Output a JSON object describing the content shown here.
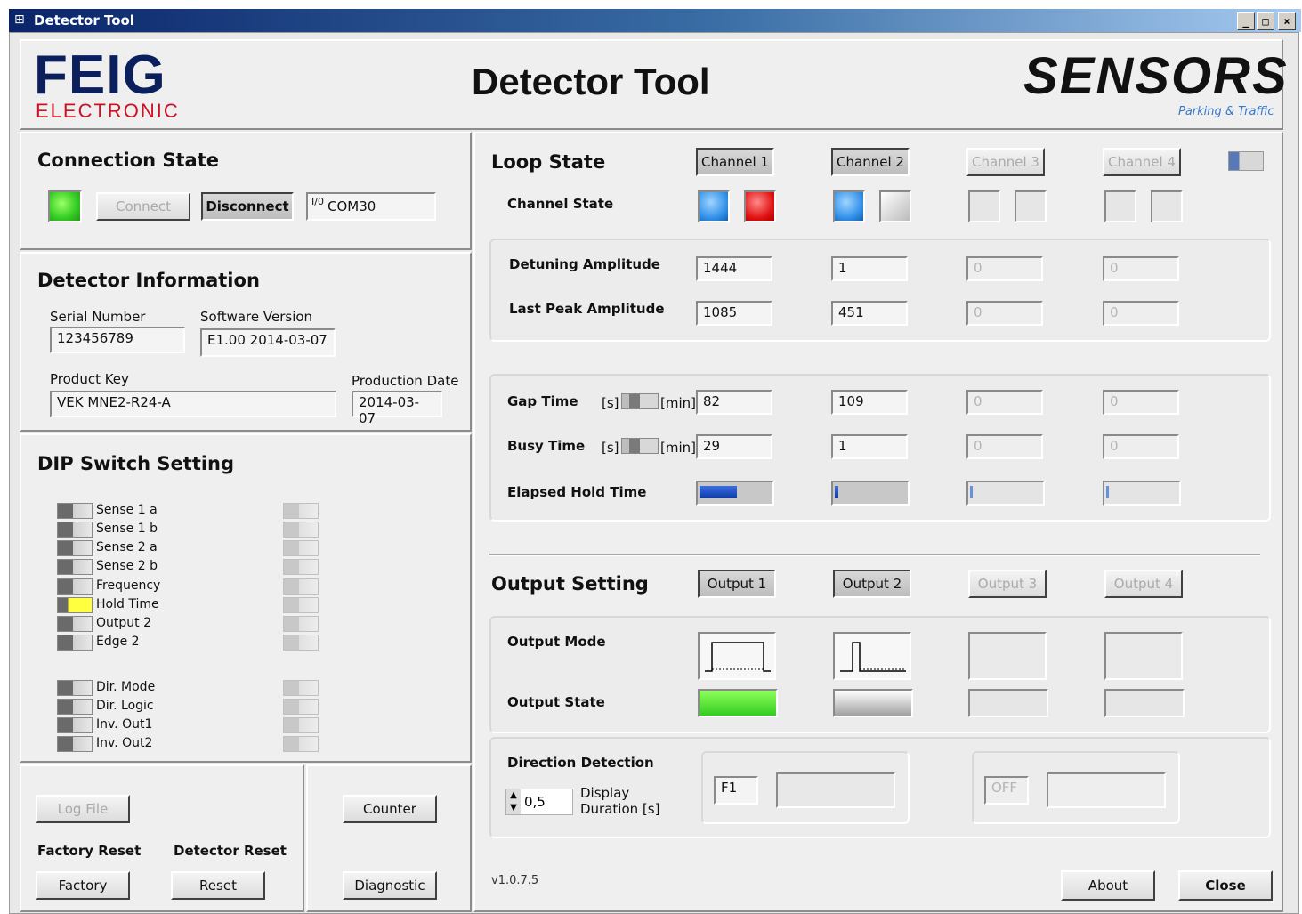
{
  "window": {
    "title": "Detector Tool",
    "min": "_",
    "max": "□",
    "close": "×"
  },
  "header": {
    "logo_main": "FEIG",
    "logo_sub": "ELECTRONIC",
    "app_title": "Detector Tool",
    "brand": "SENSORS",
    "brand_sub": "Parking & Traffic"
  },
  "connection": {
    "title": "Connection State",
    "connect": "Connect",
    "disconnect": "Disconnect",
    "port_icon": "I/0",
    "port": "COM30"
  },
  "info": {
    "title": "Detector Information",
    "serial_label": "Serial Number",
    "serial": "123456789",
    "software_label": "Software Version",
    "software": "E1.00 2014-03-07",
    "product_key_label": "Product Key",
    "product_key": "VEK MNE2-R24-A",
    "production_label": "Production Date",
    "production": "2014-03-07"
  },
  "dip": {
    "title": "DIP Switch Setting",
    "items": [
      "Sense 1 a",
      "Sense 1 b",
      "Sense 2 a",
      "Sense 2 b",
      "Frequency",
      "Hold Time",
      "Output 2",
      "Edge 2",
      "Dir. Mode",
      "Dir. Logic",
      "Inv. Out1",
      "Inv. Out2"
    ]
  },
  "bottom_left": {
    "log_file": "Log File",
    "factory_reset_label": "Factory Reset",
    "detector_reset_label": "Detector Reset",
    "factory": "Factory",
    "reset": "Reset",
    "counter": "Counter",
    "diagnostic": "Diagnostic"
  },
  "loop": {
    "title": "Loop State",
    "channels": [
      "Channel 1",
      "Channel 2",
      "Channel 3",
      "Channel 4"
    ],
    "channel_state_label": "Channel State",
    "detuning_label": "Detuning Amplitude",
    "detuning": [
      "1444",
      "1",
      "0",
      "0"
    ],
    "last_peak_label": "Last Peak Amplitude",
    "last_peak": [
      "1085",
      "451",
      "0",
      "0"
    ],
    "gap_label": "Gap Time",
    "busy_label": "Busy Time",
    "unit_s": "[s]",
    "unit_min": "[min]",
    "gap": [
      "82",
      "109",
      "0",
      "0"
    ],
    "busy": [
      "29",
      "1",
      "0",
      "0"
    ],
    "elapsed_label": "Elapsed Hold Time",
    "elapsed_fraction": [
      0.5,
      0.05,
      0.03,
      0.03
    ]
  },
  "output": {
    "title": "Output Setting",
    "outputs": [
      "Output 1",
      "Output 2",
      "Output 3",
      "Output 4"
    ],
    "mode_label": "Output Mode",
    "state_label": "Output State",
    "direction_label": "Direction Detection",
    "display_value": "0,5",
    "display_label_1": "Display",
    "display_label_2": "Duration [s]",
    "dir_1": "F1",
    "dir_2": "OFF"
  },
  "footer": {
    "version": "v1.0.7.5",
    "about": "About",
    "close": "Close"
  },
  "colors": {
    "led_green": "#33cc22",
    "led_blue": "#2f8fe8",
    "led_red": "#e01010",
    "brand_red": "#cc1122",
    "brand_navy": "#0b1f5c",
    "title_bar": "#0a246a"
  }
}
